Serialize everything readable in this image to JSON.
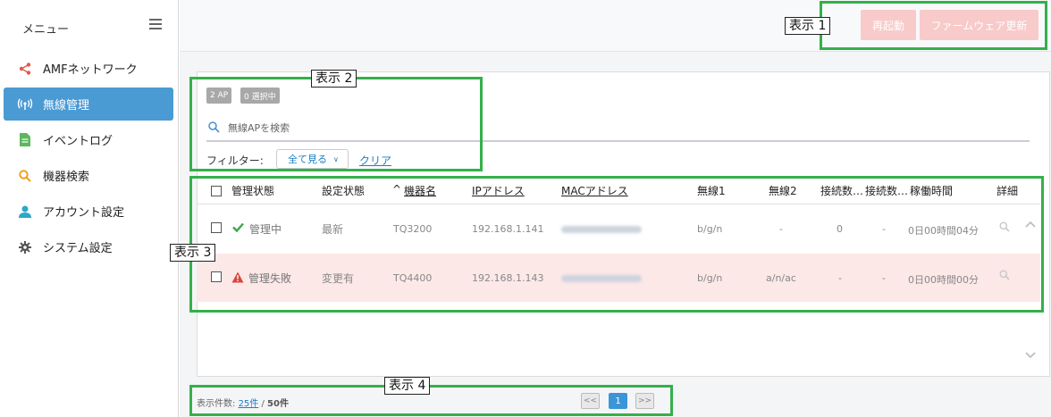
{
  "sidebar": {
    "title": "メニュー",
    "items": [
      {
        "label": "AMFネットワーク",
        "icon": "share-icon",
        "color": "#e05a4a",
        "active": false
      },
      {
        "label": "無線管理",
        "icon": "wireless-icon",
        "color": "#ffffff",
        "active": true
      },
      {
        "label": "イベントログ",
        "icon": "document-icon",
        "color": "#5cb85c",
        "active": false
      },
      {
        "label": "機器検索",
        "icon": "search-icon",
        "color": "#f0a020",
        "active": false
      },
      {
        "label": "アカウント設定",
        "icon": "user-icon",
        "color": "#2aa8c8",
        "active": false
      },
      {
        "label": "システム設定",
        "icon": "gear-icon",
        "color": "#555555",
        "active": false
      }
    ]
  },
  "toolbar": {
    "restart_label": "再起動",
    "firmware_label": "ファームウェア更新"
  },
  "list": {
    "ap_count_badge": "2 AP",
    "selected_badge": "0 選択中",
    "search_placeholder": "無線APを検索",
    "filter_label": "フィルター:",
    "filter_value": "全て見る",
    "clear_label": "クリア",
    "columns": [
      "管理状態",
      "設定状態",
      "機器名",
      "IPアドレス",
      "MACアドレス",
      "無線1",
      "無線2",
      "接続数…",
      "接続数…",
      "稼働時間",
      "詳細"
    ],
    "rows": [
      {
        "status": "管理中",
        "status_icon": "check-icon",
        "config": "最新",
        "name": "TQ3200",
        "ip": "192.168.1.141",
        "radio1": "b/g/n",
        "radio2": "-",
        "conn1": "0",
        "conn2": "-",
        "uptime": "0日00時間04分",
        "state": "ok"
      },
      {
        "status": "管理失敗",
        "status_icon": "warning-icon",
        "config": "変更有",
        "name": "TQ4400",
        "ip": "192.168.1.143",
        "radio1": "b/g/n",
        "radio2": "a/n/ac",
        "conn1": "-",
        "conn2": "-",
        "uptime": "0日00時間00分",
        "state": "error"
      }
    ]
  },
  "footer": {
    "count_label": "表示件数:",
    "per_page": "25件",
    "separator": "/",
    "total": "50件",
    "prev": "<<",
    "page": "1",
    "next": ">>"
  },
  "annotations": {
    "label1": "表示 1",
    "label2": "表示 2",
    "label3": "表示 3",
    "label4": "表示 4"
  },
  "colors": {
    "accent": "#4a9ad4",
    "annotation": "#34b04a",
    "error_row": "#fde8e8",
    "button_disabled": "#f8caca"
  }
}
